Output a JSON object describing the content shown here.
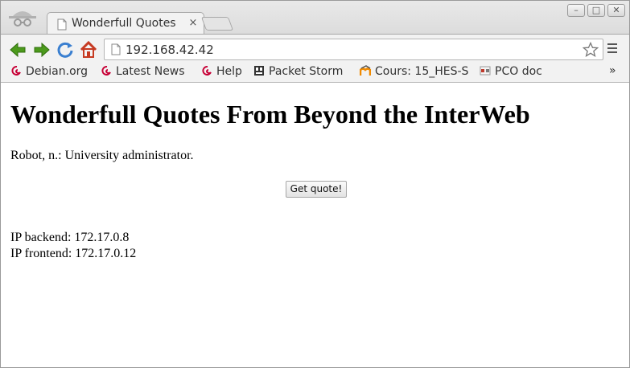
{
  "browser": {
    "tab": {
      "title": "Wonderfull Quotes",
      "close_glyph": "×"
    },
    "window_controls": {
      "minimize": "–",
      "maximize": "□",
      "close": "✕"
    },
    "address_bar": {
      "url": "192.168.42.42"
    },
    "bookmarks": [
      {
        "label": "Debian.org",
        "icon": "debian-icon"
      },
      {
        "label": "Latest News",
        "icon": "debian-icon"
      },
      {
        "label": "Help",
        "icon": "debian-icon"
      },
      {
        "label": "Packet Storm",
        "icon": "packet-storm-icon"
      },
      {
        "label": "Cours: 15_HES-S",
        "icon": "moodle-icon"
      },
      {
        "label": "PCO doc",
        "icon": "pco-doc-icon"
      }
    ],
    "bookmarks_overflow": "»"
  },
  "page": {
    "heading": "Wonderfull Quotes From Beyond the InterWeb",
    "quote": "Robot, n.: University administrator.",
    "button_label": "Get quote!",
    "ip_backend": "IP backend: 172.17.0.8",
    "ip_frontend": "IP frontend: 172.17.0.12"
  },
  "colors": {
    "nav_arrows": "#4c9a1c",
    "reload": "#3a7fd0",
    "home": "#c63a22",
    "debian": "#c70036"
  }
}
